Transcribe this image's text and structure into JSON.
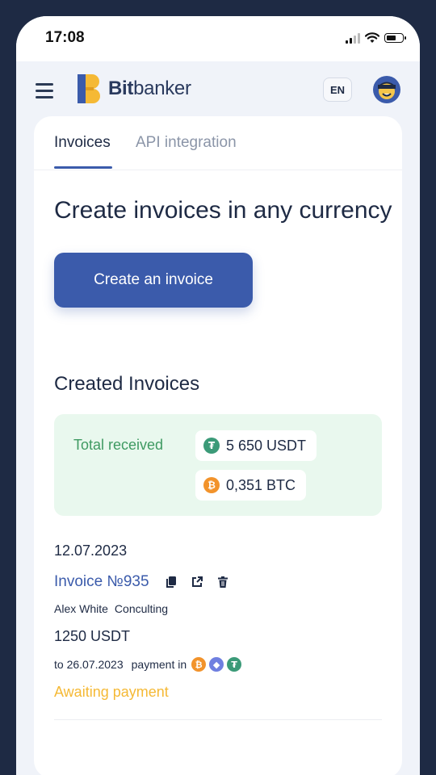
{
  "status_bar": {
    "time": "17:08"
  },
  "header": {
    "brand_bold": "Bit",
    "brand_rest": "banker",
    "language": "EN"
  },
  "tabs": [
    {
      "label": "Invoices",
      "active": true
    },
    {
      "label": "API integration",
      "active": false
    }
  ],
  "main": {
    "headline": "Create invoices in any currency",
    "create_button": "Create an invoice",
    "created_title": "Created Invoices"
  },
  "summary": {
    "label": "Total received",
    "totals": [
      {
        "amount": "5 650 USDT",
        "icon": "tether-icon"
      },
      {
        "amount": "0,351 BTC",
        "icon": "bitcoin-icon"
      }
    ]
  },
  "invoice": {
    "date": "12.07.2023",
    "title": "Invoice №935",
    "client": "Alex White",
    "description": "Conculting",
    "amount": "1250 USDT",
    "due": "to 26.07.2023",
    "payment_label": "payment in",
    "payment_icons": [
      "bitcoin-icon",
      "ethereum-icon",
      "tether-icon"
    ],
    "status": "Awaiting payment"
  },
  "colors": {
    "primary": "#3b5bab",
    "success_bg": "#e9f8ee",
    "success_text": "#3f9a62",
    "warning": "#f5b935",
    "tether": "#3b9a78",
    "bitcoin": "#f2932b",
    "ethereum": "#6f7fe0"
  }
}
